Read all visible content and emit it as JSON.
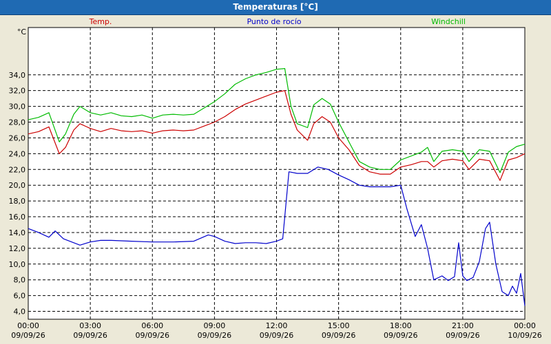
{
  "title": "Temperaturas [°C]",
  "chart_data": {
    "type": "line",
    "title": "Temperaturas [°C]",
    "ylabel": "°C",
    "ylim": [
      3.0,
      40.0
    ],
    "yticks": [
      4,
      6,
      8,
      10,
      12,
      14,
      16,
      18,
      20,
      22,
      24,
      26,
      28,
      30,
      32,
      34
    ],
    "ytick_labels": [
      "4,0",
      "6,0",
      "8,0",
      "10,0",
      "12,0",
      "14,0",
      "16,0",
      "18,0",
      "20,0",
      "22,0",
      "24,0",
      "26,0",
      "28,0",
      "30,0",
      "32,0",
      "34,0"
    ],
    "xlim": [
      0,
      24
    ],
    "xticks": [
      0,
      3,
      6,
      9,
      12,
      15,
      18,
      21,
      24
    ],
    "xtick_labels": [
      [
        "00:00",
        "09/09/26"
      ],
      [
        "03:00",
        "09/09/26"
      ],
      [
        "06:00",
        "09/09/26"
      ],
      [
        "09:00",
        "09/09/26"
      ],
      [
        "12:00",
        "09/09/26"
      ],
      [
        "15:00",
        "09/09/26"
      ],
      [
        "18:00",
        "09/09/26"
      ],
      [
        "21:00",
        "09/09/26"
      ],
      [
        "00:00",
        "10/09/26"
      ]
    ],
    "grid": true,
    "legend_position": "top",
    "series": [
      {
        "name": "Temp.",
        "color": "#cc0000",
        "points": [
          [
            0,
            26.5
          ],
          [
            0.5,
            26.8
          ],
          [
            1.0,
            27.4
          ],
          [
            1.5,
            24.0
          ],
          [
            1.8,
            24.8
          ],
          [
            2.2,
            27.0
          ],
          [
            2.5,
            27.8
          ],
          [
            3,
            27.2
          ],
          [
            3.5,
            26.8
          ],
          [
            4,
            27.2
          ],
          [
            4.5,
            26.9
          ],
          [
            5,
            26.8
          ],
          [
            5.5,
            26.9
          ],
          [
            6,
            26.6
          ],
          [
            6.5,
            26.9
          ],
          [
            7,
            27.0
          ],
          [
            7.5,
            26.9
          ],
          [
            8,
            27.0
          ],
          [
            8.5,
            27.5
          ],
          [
            9,
            28.0
          ],
          [
            9.5,
            28.7
          ],
          [
            10,
            29.6
          ],
          [
            10.5,
            30.3
          ],
          [
            11,
            30.8
          ],
          [
            11.5,
            31.3
          ],
          [
            12,
            31.8
          ],
          [
            12.4,
            32.0
          ],
          [
            12.7,
            29.0
          ],
          [
            13.0,
            27.0
          ],
          [
            13.5,
            25.7
          ],
          [
            13.8,
            27.8
          ],
          [
            14.2,
            28.7
          ],
          [
            14.6,
            28.0
          ],
          [
            15,
            26.0
          ],
          [
            15.5,
            24.5
          ],
          [
            16,
            22.5
          ],
          [
            16.5,
            21.7
          ],
          [
            17,
            21.4
          ],
          [
            17.5,
            21.4
          ],
          [
            18,
            22.3
          ],
          [
            18.5,
            22.6
          ],
          [
            19,
            23.0
          ],
          [
            19.3,
            23.0
          ],
          [
            19.6,
            22.3
          ],
          [
            20,
            23.1
          ],
          [
            20.5,
            23.3
          ],
          [
            21,
            23.1
          ],
          [
            21.3,
            22.0
          ],
          [
            21.8,
            23.3
          ],
          [
            22.3,
            23.1
          ],
          [
            22.8,
            20.6
          ],
          [
            23.2,
            23.2
          ],
          [
            23.6,
            23.5
          ],
          [
            24,
            24.0
          ]
        ]
      },
      {
        "name": "Punto de rocío",
        "color": "#0000cc",
        "points": [
          [
            0,
            14.5
          ],
          [
            0.5,
            14.0
          ],
          [
            1.0,
            13.4
          ],
          [
            1.3,
            14.2
          ],
          [
            1.7,
            13.2
          ],
          [
            2.5,
            12.4
          ],
          [
            3,
            12.8
          ],
          [
            3.5,
            13.0
          ],
          [
            4,
            13.0
          ],
          [
            5,
            12.9
          ],
          [
            6,
            12.8
          ],
          [
            7,
            12.8
          ],
          [
            8,
            12.9
          ],
          [
            8.7,
            13.7
          ],
          [
            9,
            13.5
          ],
          [
            9.5,
            12.9
          ],
          [
            10,
            12.6
          ],
          [
            10.5,
            12.7
          ],
          [
            11,
            12.7
          ],
          [
            11.5,
            12.6
          ],
          [
            12,
            12.9
          ],
          [
            12.3,
            13.2
          ],
          [
            12.6,
            21.7
          ],
          [
            13,
            21.5
          ],
          [
            13.5,
            21.5
          ],
          [
            14,
            22.3
          ],
          [
            14.5,
            22.0
          ],
          [
            15,
            21.3
          ],
          [
            15.5,
            20.7
          ],
          [
            16,
            20.0
          ],
          [
            16.5,
            19.8
          ],
          [
            17,
            19.8
          ],
          [
            17.5,
            19.8
          ],
          [
            18,
            20.0
          ],
          [
            18.3,
            17.0
          ],
          [
            18.7,
            13.5
          ],
          [
            19,
            15.0
          ],
          [
            19.3,
            12.0
          ],
          [
            19.6,
            8.0
          ],
          [
            20,
            8.5
          ],
          [
            20.3,
            7.9
          ],
          [
            20.6,
            8.4
          ],
          [
            20.8,
            12.7
          ],
          [
            21,
            8.5
          ],
          [
            21.2,
            7.9
          ],
          [
            21.5,
            8.3
          ],
          [
            21.8,
            10.3
          ],
          [
            22.1,
            14.5
          ],
          [
            22.3,
            15.3
          ],
          [
            22.6,
            10.0
          ],
          [
            22.9,
            6.5
          ],
          [
            23.2,
            6.0
          ],
          [
            23.4,
            7.2
          ],
          [
            23.6,
            6.3
          ],
          [
            23.8,
            8.8
          ],
          [
            24,
            4.7
          ]
        ]
      },
      {
        "name": "Windchill",
        "color": "#00bb00",
        "points": [
          [
            0,
            28.3
          ],
          [
            0.5,
            28.6
          ],
          [
            1.0,
            29.2
          ],
          [
            1.5,
            25.5
          ],
          [
            1.8,
            26.5
          ],
          [
            2.2,
            29.0
          ],
          [
            2.5,
            30.0
          ],
          [
            3,
            29.2
          ],
          [
            3.5,
            28.9
          ],
          [
            4,
            29.2
          ],
          [
            4.5,
            28.8
          ],
          [
            5,
            28.7
          ],
          [
            5.5,
            28.9
          ],
          [
            6,
            28.5
          ],
          [
            6.5,
            28.9
          ],
          [
            7,
            29.0
          ],
          [
            7.5,
            28.9
          ],
          [
            8,
            29.0
          ],
          [
            8.5,
            29.8
          ],
          [
            9,
            30.6
          ],
          [
            9.5,
            31.6
          ],
          [
            10,
            32.8
          ],
          [
            10.5,
            33.5
          ],
          [
            11,
            34.0
          ],
          [
            11.5,
            34.3
          ],
          [
            12,
            34.7
          ],
          [
            12.4,
            34.8
          ],
          [
            12.7,
            30.0
          ],
          [
            13.0,
            27.8
          ],
          [
            13.5,
            27.3
          ],
          [
            13.8,
            30.2
          ],
          [
            14.2,
            31.0
          ],
          [
            14.6,
            30.3
          ],
          [
            15,
            28.0
          ],
          [
            15.5,
            25.5
          ],
          [
            16,
            23.0
          ],
          [
            16.5,
            22.3
          ],
          [
            17,
            22.0
          ],
          [
            17.5,
            22.0
          ],
          [
            18,
            23.2
          ],
          [
            18.5,
            23.7
          ],
          [
            19,
            24.2
          ],
          [
            19.3,
            24.8
          ],
          [
            19.6,
            23.0
          ],
          [
            20,
            24.3
          ],
          [
            20.5,
            24.5
          ],
          [
            21,
            24.3
          ],
          [
            21.3,
            23.0
          ],
          [
            21.8,
            24.5
          ],
          [
            22.3,
            24.3
          ],
          [
            22.8,
            21.6
          ],
          [
            23.2,
            24.2
          ],
          [
            23.6,
            24.9
          ],
          [
            24,
            25.2
          ]
        ]
      }
    ]
  }
}
